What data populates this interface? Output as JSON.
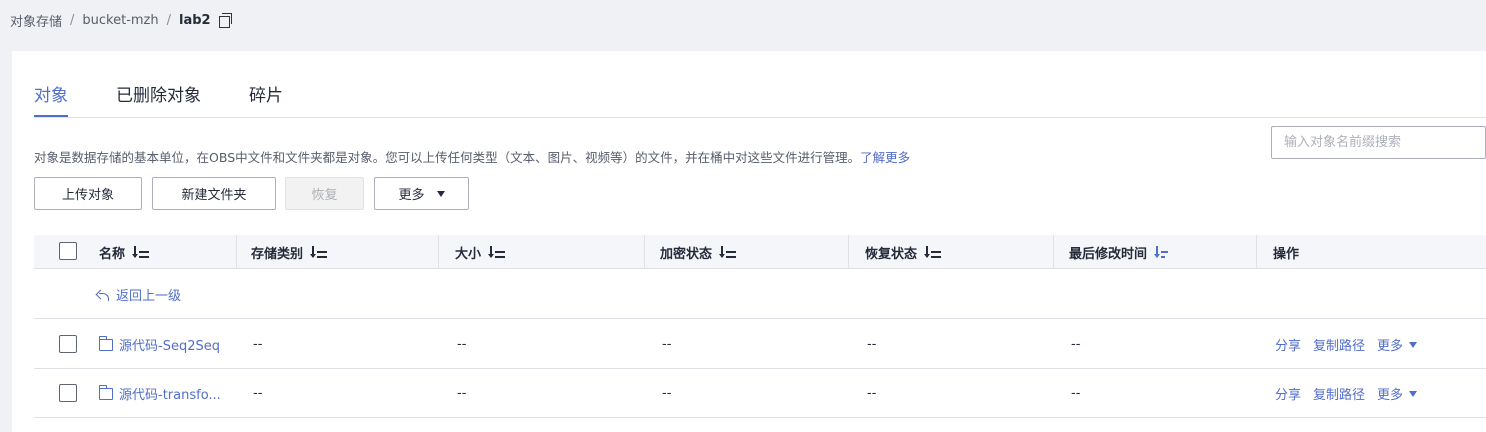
{
  "breadcrumb": {
    "items": [
      "对象存储",
      "bucket-mzh"
    ],
    "separator": "/",
    "current": "lab2"
  },
  "tabs": [
    {
      "label": "对象",
      "active": true
    },
    {
      "label": "已删除对象",
      "active": false
    },
    {
      "label": "碎片",
      "active": false
    }
  ],
  "description": {
    "text": "对象是数据存储的基本单位，在OBS中文件和文件夹都是对象。您可以上传任何类型（文本、图片、视频等）的文件，并在桶中对这些文件进行管理。",
    "link": "了解更多"
  },
  "toolbar": {
    "upload": "上传对象",
    "new_folder": "新建文件夹",
    "restore": "恢复",
    "more": "更多"
  },
  "search": {
    "placeholder": "输入对象名前缀搜索"
  },
  "table": {
    "columns": [
      "名称",
      "存储类别",
      "大小",
      "加密状态",
      "恢复状态",
      "最后修改时间",
      "操作"
    ],
    "back_label": "返回上一级",
    "rows": [
      {
        "name": "源代码-Seq2Seq",
        "storage": "--",
        "size": "--",
        "encryption": "--",
        "restore": "--",
        "modified": "--"
      },
      {
        "name": "源代码-transfo...",
        "storage": "--",
        "size": "--",
        "encryption": "--",
        "restore": "--",
        "modified": "--"
      }
    ],
    "actions": {
      "share": "分享",
      "copy_path": "复制路径",
      "more": "更多"
    }
  },
  "colors": {
    "accent": "#526ecc",
    "text": "#252b3a",
    "header_bg": "#f5f6fa",
    "page_bg": "#f0f1f5"
  }
}
